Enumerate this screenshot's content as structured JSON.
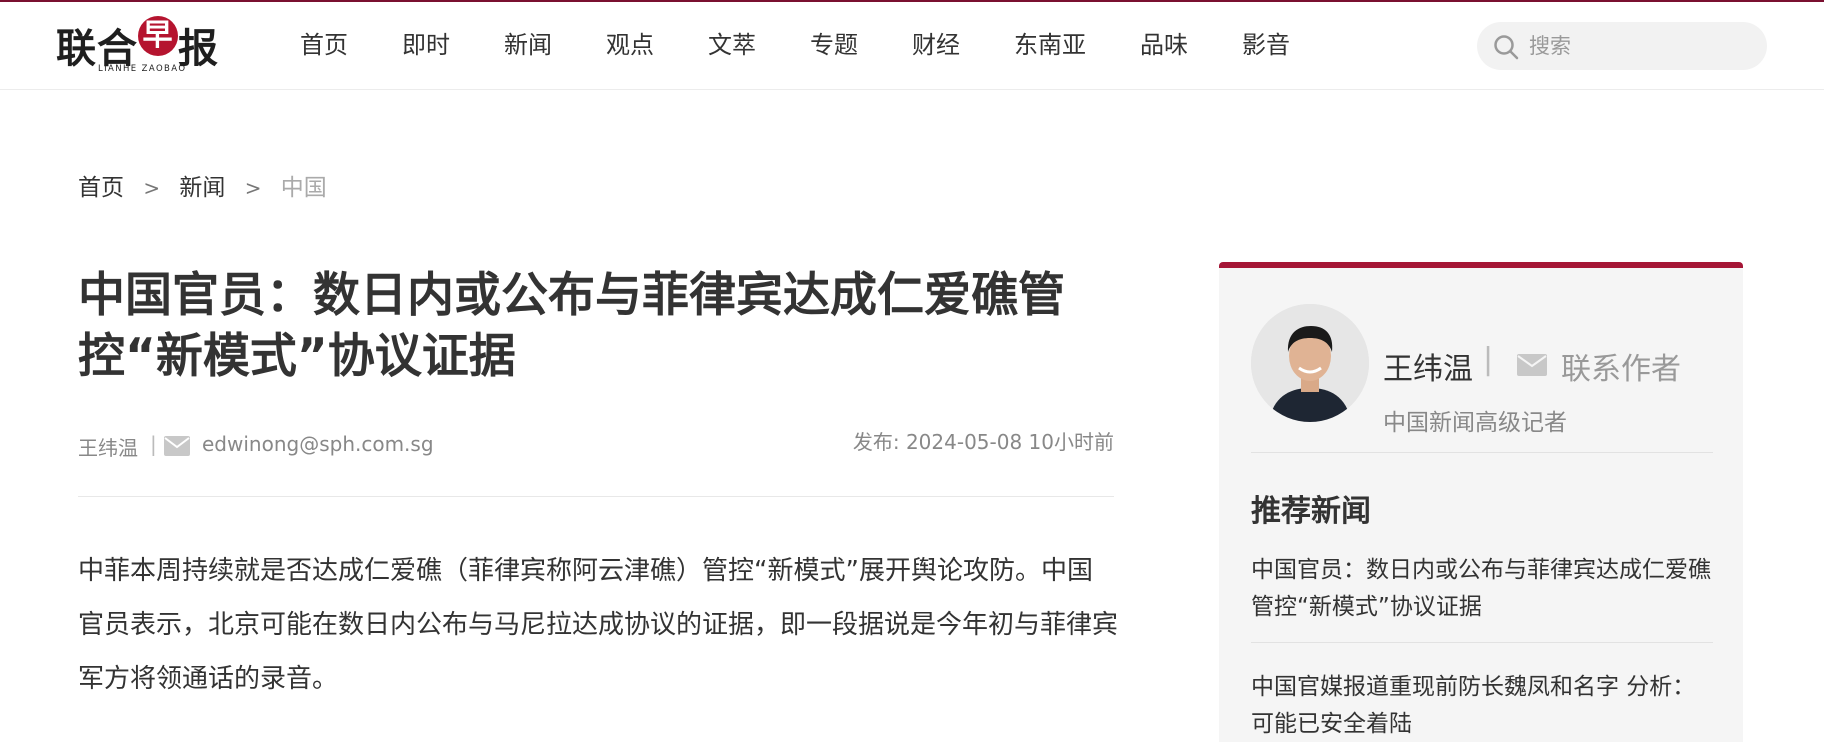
{
  "header": {
    "logo_cn": "联合",
    "logo_badge": "早",
    "logo_cn_tail": "报",
    "logo_en": "LIANHE ZAOBAO",
    "nav": [
      "首页",
      "即时",
      "新闻",
      "观点",
      "文萃",
      "专题",
      "财经",
      "东南亚",
      "品味",
      "影音"
    ],
    "search": {
      "placeholder": "搜索",
      "value": ""
    }
  },
  "breadcrumb": {
    "items": [
      "首页",
      "新闻"
    ],
    "separator": ">",
    "current": "中国"
  },
  "article": {
    "title": "中国官员：数日内或公布与菲律宾达成仁爱礁管控“新模式”协议证据",
    "author": "王纬温",
    "author_separator": "|",
    "email": "edwinong@sph.com.sg",
    "published": "发布: 2024-05-08 10小时前",
    "lede": "中菲本周持续就是否达成仁爱礁（菲律宾称阿云津礁）管控“新模式”展开舆论攻防。中国官员表示，北京可能在数日内公布与马尼拉达成协议的证据，即一段据说是今年初与菲律宾军方将领通话的录音。"
  },
  "sidebar": {
    "author_name": "王纬温",
    "author_separator": "|",
    "contact_label": "联系作者",
    "author_role": "中国新闻高级记者",
    "heading": "推荐新闻",
    "recommended": [
      "中国官员：数日内或公布与菲律宾达成仁爱礁管控“新模式”协议证据",
      "中国官媒报道重现前防长魏凤和名字 分析：可能已安全着陆"
    ]
  },
  "colors": {
    "accent": "#a51636",
    "topline": "#7a1030",
    "logo_badge": "#b5142f"
  },
  "icons": {
    "search": "search-icon",
    "mail": "mail-icon",
    "contact": "mail-icon"
  }
}
